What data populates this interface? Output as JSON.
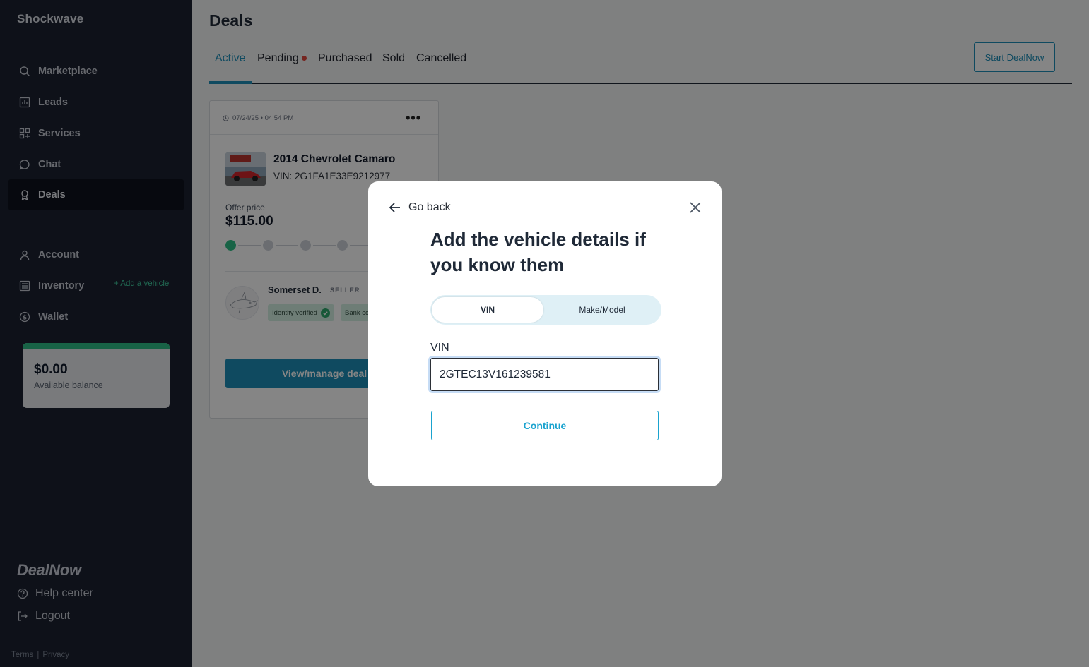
{
  "app": {
    "brand": "Shockwave"
  },
  "sidebar": {
    "nav": [
      {
        "label": "Marketplace",
        "icon": "search-icon"
      },
      {
        "label": "Leads",
        "icon": "chart-icon"
      },
      {
        "label": "Services",
        "icon": "grid-icon"
      },
      {
        "label": "Chat",
        "icon": "chat-bubble-icon"
      },
      {
        "label": "Deals",
        "icon": "award-icon"
      }
    ],
    "nav2": [
      {
        "label": "Account",
        "icon": "user-icon"
      },
      {
        "label": "Inventory",
        "icon": "list-icon"
      },
      {
        "label": "Wallet",
        "icon": "dollar-icon"
      }
    ],
    "add_vehicle": "+ Add a vehicle",
    "wallet": {
      "amount": "$0.00",
      "label": "Available balance"
    },
    "logo_text": "DealNow",
    "help": "Help center",
    "logout": "Logout",
    "terms": "Terms",
    "separator": "|",
    "privacy": "Privacy"
  },
  "main": {
    "title": "Deals",
    "tabs": [
      "Active",
      "Pending",
      "Purchased",
      "Sold",
      "Cancelled"
    ],
    "active_tab": "Active",
    "start_button": "Start DealNow",
    "card": {
      "date": "07/24/25 • 04:54 PM",
      "menu": "•••",
      "car_name": "2014 Chevrolet Camaro",
      "vin": "VIN:  2G1FA1E33E9212977",
      "offer_label": "Offer price",
      "offer_price": "$115.00",
      "progress_completed_steps": 1,
      "seller_name": "Somerset D.",
      "seller_role": "SELLER",
      "badge1": "Identity verified",
      "badge2": "Bank co",
      "view_button": "View/manage deal"
    }
  },
  "modal": {
    "back_label": "Go back",
    "title": "Add the vehicle details if you know them",
    "toggle": {
      "options": [
        "VIN",
        "Make/Model"
      ],
      "selected": "VIN"
    },
    "field_label": "VIN",
    "vin_value": "2GTEC13V161239581",
    "continue": "Continue"
  },
  "colors": {
    "accent": "#1e8fb8",
    "success": "#2fbf86",
    "sidebar_bg": "#1b2130",
    "alert": "#e0473e"
  }
}
